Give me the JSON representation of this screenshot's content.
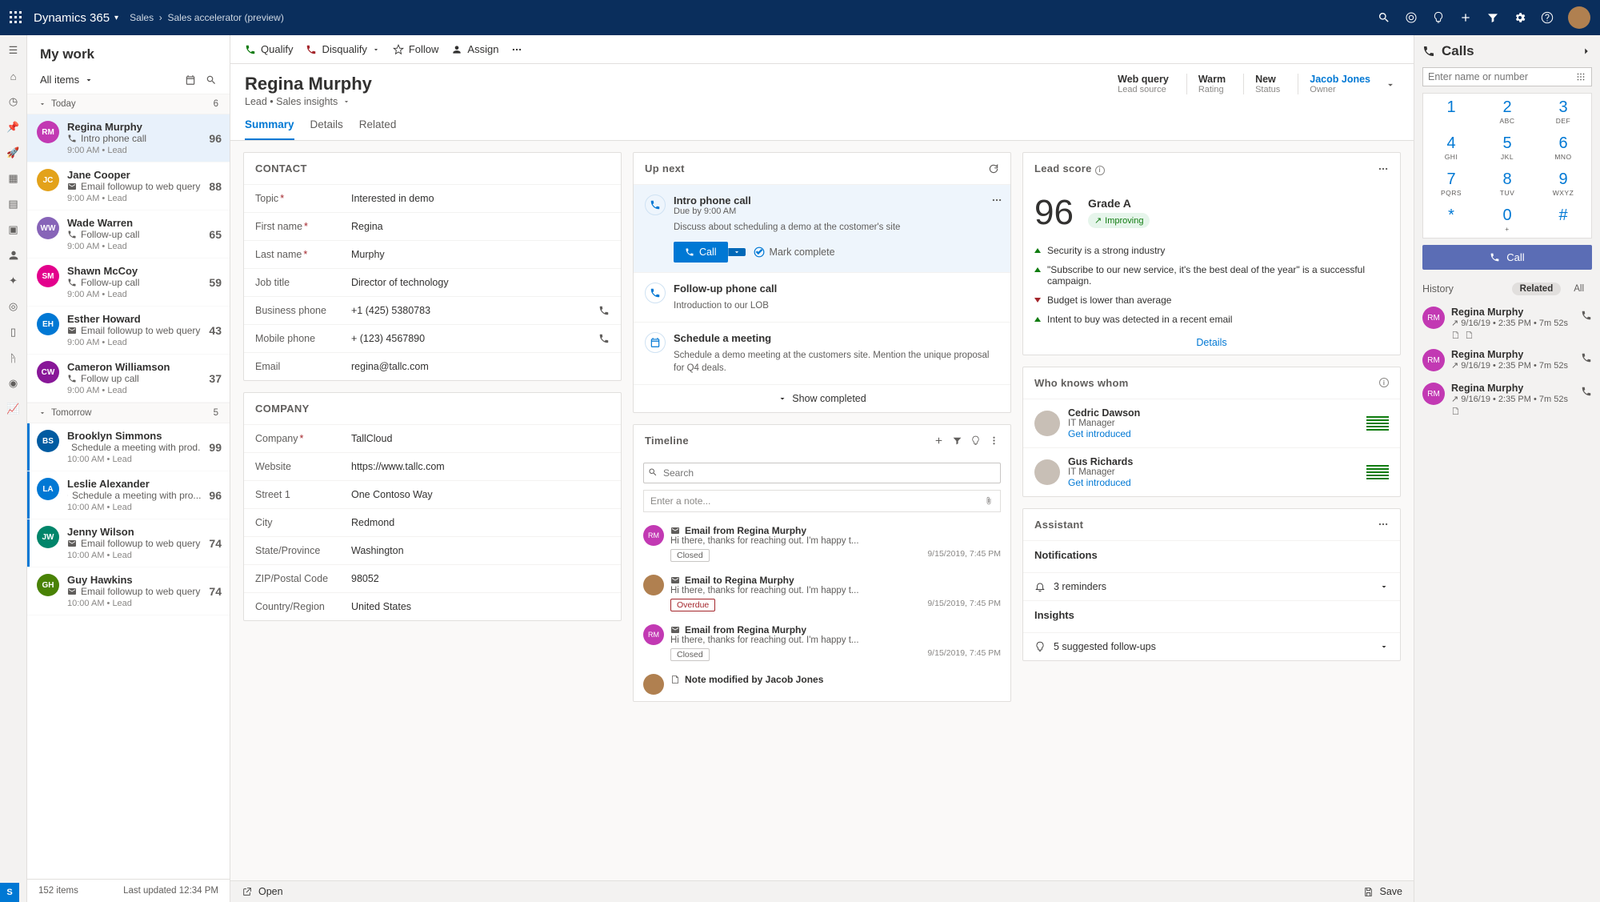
{
  "nav": {
    "brand": "Dynamics 365",
    "breadcrumb_area": "Sales",
    "breadcrumb_page": "Sales accelerator (preview)"
  },
  "workPanel": {
    "title": "My work",
    "filter": "All items",
    "groups": [
      {
        "label": "Today",
        "count": 6
      },
      {
        "label": "Tomorrow",
        "count": 5
      }
    ],
    "footer_count": "152 items",
    "footer_updated": "Last updated 12:34 PM"
  },
  "workItems": [
    {
      "group": 0,
      "initials": "RM",
      "color": "#c239b3",
      "name": "Regina Murphy",
      "activity_icon": "phone",
      "activity": "Intro phone call",
      "meta": "9:00 AM • Lead",
      "score": 96,
      "selected": true
    },
    {
      "group": 0,
      "initials": "JC",
      "color": "#e3a21a",
      "name": "Jane Cooper",
      "activity_icon": "mail",
      "activity": "Email followup to web query",
      "meta": "9:00 AM • Lead",
      "score": 88
    },
    {
      "group": 0,
      "initials": "WW",
      "color": "#8764b8",
      "name": "Wade Warren",
      "activity_icon": "phone",
      "activity": "Follow-up call",
      "meta": "9:00 AM • Lead",
      "score": 65
    },
    {
      "group": 0,
      "initials": "SM",
      "color": "#e3008c",
      "name": "Shawn McCoy",
      "activity_icon": "phone",
      "activity": "Follow-up call",
      "meta": "9:00 AM • Lead",
      "score": 59
    },
    {
      "group": 0,
      "initials": "EH",
      "color": "#0078d4",
      "name": "Esther Howard",
      "activity_icon": "mail",
      "activity": "Email followup to web query",
      "meta": "9:00 AM • Lead",
      "score": 43
    },
    {
      "group": 0,
      "initials": "CW",
      "color": "#881798",
      "name": "Cameron Williamson",
      "activity_icon": "phone",
      "activity": "Follow up call",
      "meta": "9:00 AM • Lead",
      "score": 37
    },
    {
      "group": 1,
      "initials": "BS",
      "color": "#005ba1",
      "name": "Brooklyn Simmons",
      "activity_icon": "phone",
      "activity": "Schedule a meeting with prod..",
      "meta": "10:00 AM • Lead",
      "score": 99,
      "marked": true
    },
    {
      "group": 1,
      "initials": "LA",
      "color": "#0078d4",
      "name": "Leslie Alexander",
      "activity_icon": "phone",
      "activity": "Schedule a meeting with pro...",
      "meta": "10:00 AM • Lead",
      "score": 96,
      "marked": true
    },
    {
      "group": 1,
      "initials": "JW",
      "color": "#00856a",
      "name": "Jenny Wilson",
      "activity_icon": "mail",
      "activity": "Email followup to web query",
      "meta": "10:00 AM • Lead",
      "score": 74,
      "marked": true
    },
    {
      "group": 1,
      "initials": "GH",
      "color": "#498205",
      "name": "Guy Hawkins",
      "activity_icon": "mail",
      "activity": "Email followup to web query",
      "meta": "10:00 AM • Lead",
      "score": 74
    }
  ],
  "commands": {
    "qualify": "Qualify",
    "disqualify": "Disqualify",
    "follow": "Follow",
    "assign": "Assign"
  },
  "record": {
    "name": "Regina Murphy",
    "subtitle": "Lead • Sales insights",
    "stats": {
      "lead_source": {
        "v": "Web query",
        "l": "Lead source"
      },
      "rating": {
        "v": "Warm",
        "l": "Rating"
      },
      "status": {
        "v": "New",
        "l": "Status"
      },
      "owner": {
        "v": "Jacob Jones",
        "l": "Owner"
      }
    },
    "tabs": {
      "summary": "Summary",
      "details": "Details",
      "related": "Related"
    }
  },
  "contact": {
    "heading": "CONTACT",
    "topic": {
      "label": "Topic",
      "value": "Interested in demo",
      "req": true
    },
    "first": {
      "label": "First name",
      "value": "Regina",
      "req": true
    },
    "last": {
      "label": "Last name",
      "value": "Murphy",
      "req": true
    },
    "job": {
      "label": "Job title",
      "value": "Director of technology"
    },
    "biz": {
      "label": "Business phone",
      "value": "+1 (425) 5380783"
    },
    "mob": {
      "label": "Mobile phone",
      "value": "+ (123) 4567890"
    },
    "email": {
      "label": "Email",
      "value": "regina@tallc.com"
    }
  },
  "company": {
    "heading": "COMPANY",
    "company": {
      "label": "Company",
      "value": "TallCloud",
      "req": true
    },
    "website": {
      "label": "Website",
      "value": "https://www.tallc.com"
    },
    "street": {
      "label": "Street 1",
      "value": "One Contoso Way"
    },
    "city": {
      "label": "City",
      "value": "Redmond"
    },
    "state": {
      "label": "State/Province",
      "value": "Washington"
    },
    "zip": {
      "label": "ZIP/Postal Code",
      "value": "98052"
    },
    "country": {
      "label": "Country/Region",
      "value": "United States"
    }
  },
  "upnext": {
    "heading": "Up next",
    "items": [
      {
        "icon": "phone",
        "title": "Intro phone call",
        "due": "Due by 9:00 AM",
        "desc": "Discuss about scheduling a demo at the costomer's site",
        "call_label": "Call",
        "mark_label": "Mark complete",
        "active": true
      },
      {
        "icon": "phone",
        "title": "Follow-up phone call",
        "desc": "Introduction to our LOB"
      },
      {
        "icon": "calendar",
        "title": "Schedule a meeting",
        "desc": "Schedule a demo meeting at the customers site. Mention the unique proposal for Q4 deals."
      }
    ],
    "show_completed": "Show completed"
  },
  "leadscore": {
    "heading": "Lead score",
    "score": "96",
    "grade": "Grade A",
    "trend": "Improving",
    "reasons": [
      {
        "dir": "up",
        "text": "Security is a strong industry"
      },
      {
        "dir": "up",
        "text": "\"Subscribe to our new service, it's the best deal of the year\" is a successful campaign."
      },
      {
        "dir": "down",
        "text": "Budget is lower than average"
      },
      {
        "dir": "up",
        "text": "Intent to buy was detected in a recent email"
      }
    ],
    "details": "Details"
  },
  "wkw": {
    "heading": "Who knows whom",
    "people": [
      {
        "name": "Cedric Dawson",
        "title": "IT Manager",
        "link": "Get introduced"
      },
      {
        "name": "Gus Richards",
        "title": "IT Manager",
        "link": "Get introduced"
      }
    ]
  },
  "timeline": {
    "heading": "Timeline",
    "search_placeholder": "Search",
    "note_placeholder": "Enter a note...",
    "items": [
      {
        "avc": "#c239b3",
        "avi": "RM",
        "icon": "mail",
        "title": "Email from Regina Murphy",
        "preview": "Hi there, thanks for reaching out. I'm happy t...",
        "pill": "Closed",
        "ts": "9/15/2019, 7:45 PM"
      },
      {
        "avc": "#b08050",
        "avi": "",
        "icon": "mail",
        "title": "Email to Regina Murphy",
        "preview": "Hi there, thanks for reaching out. I'm happy t...",
        "pill": "Overdue",
        "pill_cls": "overdue",
        "ts": "9/15/2019, 7:45 PM"
      },
      {
        "avc": "#c239b3",
        "avi": "RM",
        "icon": "mail",
        "title": "Email from Regina Murphy",
        "preview": "Hi there, thanks for reaching out. I'm happy t...",
        "pill": "Closed",
        "ts": "9/15/2019, 7:45 PM"
      },
      {
        "avc": "#b08050",
        "avi": "",
        "icon": "note",
        "title": "Note modified by Jacob Jones",
        "preview": ""
      }
    ]
  },
  "assistant": {
    "heading": "Assistant",
    "notifications_h": "Notifications",
    "reminders": "3 reminders",
    "insights_h": "Insights",
    "followups": "5 suggested follow-ups"
  },
  "mainFooter": {
    "open": "Open",
    "save": "Save"
  },
  "calls": {
    "heading": "Calls",
    "input_placeholder": "Enter name or number",
    "keys": [
      {
        "d": "1",
        "s": ""
      },
      {
        "d": "2",
        "s": "ABC"
      },
      {
        "d": "3",
        "s": "DEF"
      },
      {
        "d": "4",
        "s": "GHI"
      },
      {
        "d": "5",
        "s": "JKL"
      },
      {
        "d": "6",
        "s": "MNO"
      },
      {
        "d": "7",
        "s": "PQRS"
      },
      {
        "d": "8",
        "s": "TUV"
      },
      {
        "d": "9",
        "s": "WXYZ"
      },
      {
        "d": "*",
        "s": ""
      },
      {
        "d": "0",
        "s": "+"
      },
      {
        "d": "#",
        "s": ""
      }
    ],
    "call_btn": "Call",
    "history_h": "History",
    "tab_related": "Related",
    "tab_all": "All",
    "history": [
      {
        "name": "Regina Murphy",
        "meta": "9/16/19 • 2:35 PM • 7m 52s",
        "icons": 2
      },
      {
        "name": "Regina Murphy",
        "meta": "9/16/19 • 2:35 PM • 7m 52s",
        "icons": 0
      },
      {
        "name": "Regina Murphy",
        "meta": "9/16/19 • 2:35 PM • 7m 52s",
        "icons": 1
      }
    ]
  }
}
